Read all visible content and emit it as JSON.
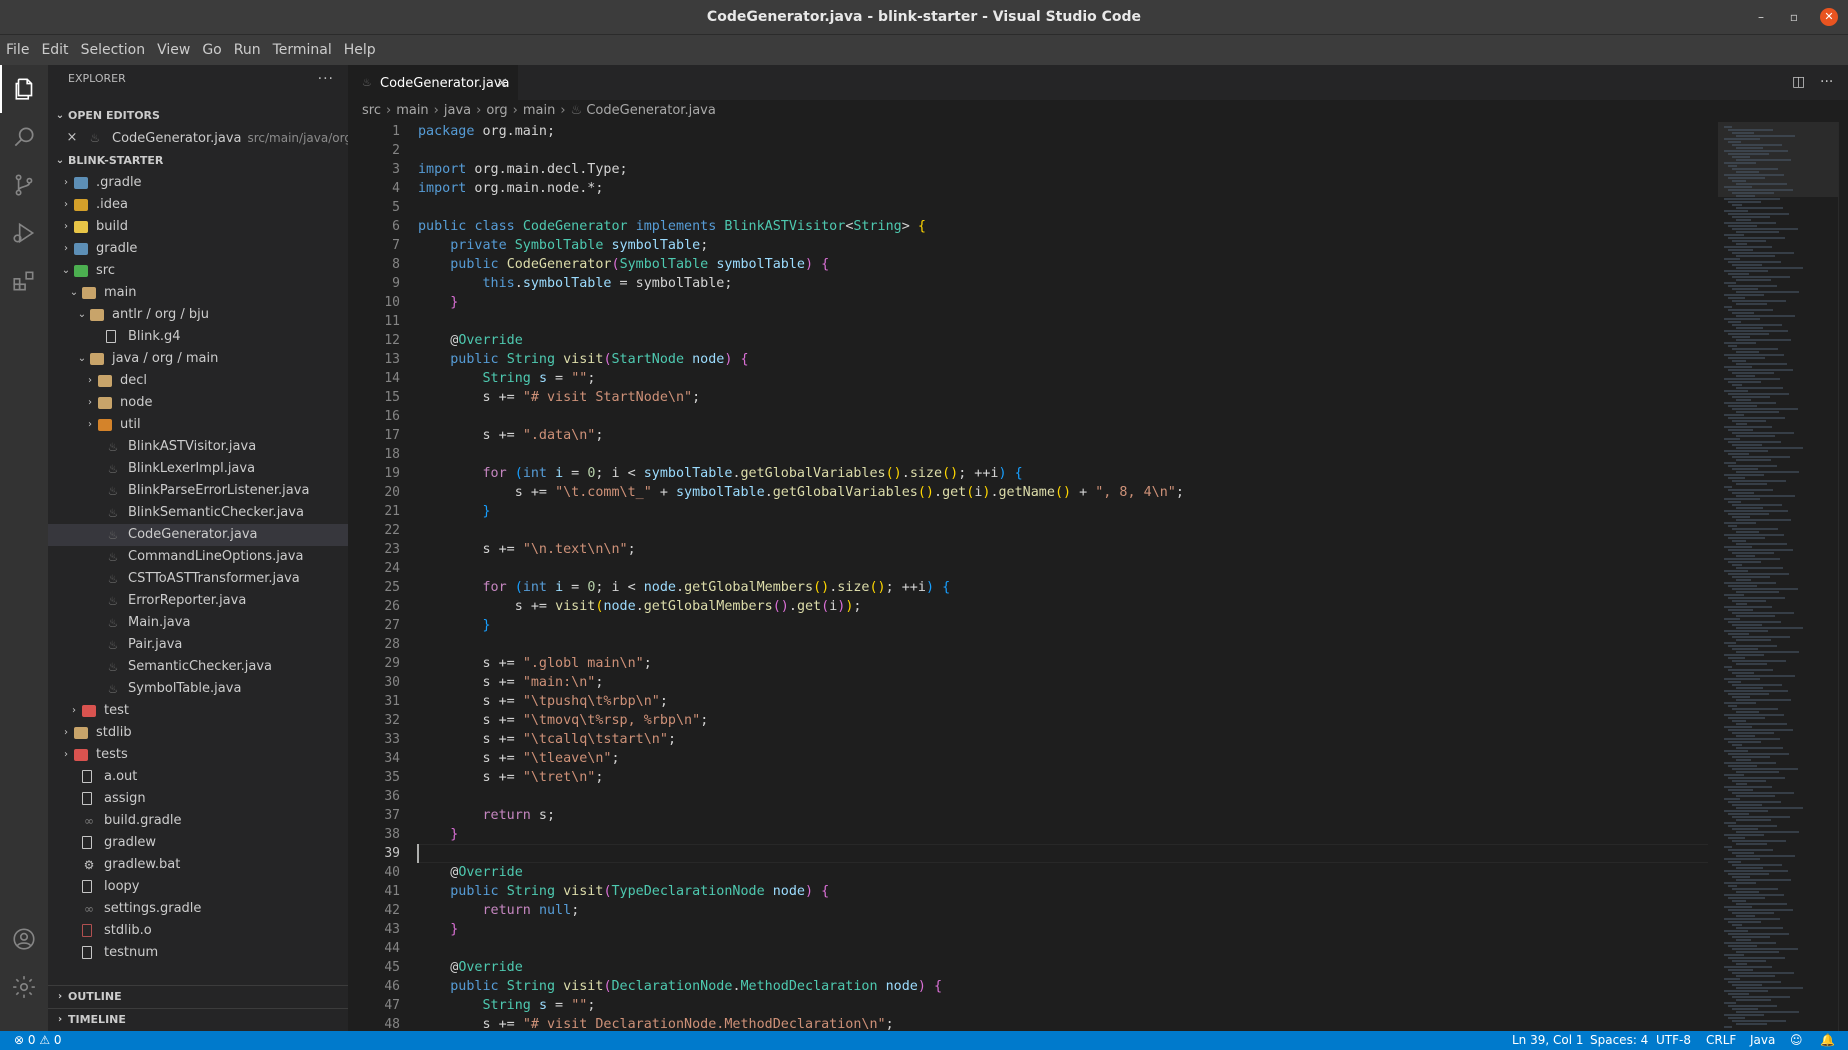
{
  "window": {
    "title": "CodeGenerator.java - blink-starter - Visual Studio Code",
    "controls": [
      "–",
      "▫",
      "✕"
    ]
  },
  "menu": [
    "File",
    "Edit",
    "Selection",
    "View",
    "Go",
    "Run",
    "Terminal",
    "Help"
  ],
  "activity_bar": {
    "top": [
      "explorer-icon",
      "search-icon",
      "source-control-icon",
      "run-debug-icon",
      "extensions-icon"
    ],
    "bottom": [
      "account-icon",
      "manage-gear-icon"
    ]
  },
  "explorer": {
    "header": "EXPLORER",
    "more": "···",
    "open_editors": {
      "title": "OPEN EDITORS",
      "items": [
        {
          "name": "CodeGenerator.java",
          "path": "src/main/java/org/..."
        }
      ]
    },
    "project": {
      "title": "BLINK-STARTER",
      "tree": [
        {
          "label": ".gradle",
          "depth": 0,
          "kind": "folder",
          "twisty": "›",
          "icon_color": "#5d8fb6"
        },
        {
          "label": ".idea",
          "depth": 0,
          "kind": "folder",
          "twisty": "›",
          "icon_color": "#d4a02a"
        },
        {
          "label": "build",
          "depth": 0,
          "kind": "folder",
          "twisty": "›",
          "icon_color": "#e8c547"
        },
        {
          "label": "gradle",
          "depth": 0,
          "kind": "folder",
          "twisty": "›",
          "icon_color": "#5d8fb6"
        },
        {
          "label": "src",
          "depth": 0,
          "kind": "folder",
          "twisty": "⌄",
          "icon_color": "#4caf50"
        },
        {
          "label": "main",
          "depth": 1,
          "kind": "folder",
          "twisty": "⌄",
          "icon_color": "#c8a46a"
        },
        {
          "label": "antlr / org / bju",
          "depth": 2,
          "kind": "folder",
          "twisty": "⌄",
          "icon_color": "#c8a46a"
        },
        {
          "label": "Blink.g4",
          "depth": 3,
          "kind": "file"
        },
        {
          "label": "java / org / main",
          "depth": 2,
          "kind": "folder",
          "twisty": "⌄",
          "icon_color": "#c8a46a"
        },
        {
          "label": "decl",
          "depth": 3,
          "kind": "folder",
          "twisty": "›",
          "icon_color": "#c8a46a"
        },
        {
          "label": "node",
          "depth": 3,
          "kind": "folder",
          "twisty": "›",
          "icon_color": "#c8a46a"
        },
        {
          "label": "util",
          "depth": 3,
          "kind": "folder",
          "twisty": "›",
          "icon_color": "#d4832a"
        },
        {
          "label": "BlinkASTVisitor.java",
          "depth": 3,
          "kind": "java"
        },
        {
          "label": "BlinkLexerImpl.java",
          "depth": 3,
          "kind": "java"
        },
        {
          "label": "BlinkParseErrorListener.java",
          "depth": 3,
          "kind": "java"
        },
        {
          "label": "BlinkSemanticChecker.java",
          "depth": 3,
          "kind": "java"
        },
        {
          "label": "CodeGenerator.java",
          "depth": 3,
          "kind": "java",
          "selected": true
        },
        {
          "label": "CommandLineOptions.java",
          "depth": 3,
          "kind": "java"
        },
        {
          "label": "CSTToASTTransformer.java",
          "depth": 3,
          "kind": "java"
        },
        {
          "label": "ErrorReporter.java",
          "depth": 3,
          "kind": "java"
        },
        {
          "label": "Main.java",
          "depth": 3,
          "kind": "java"
        },
        {
          "label": "Pair.java",
          "depth": 3,
          "kind": "java"
        },
        {
          "label": "SemanticChecker.java",
          "depth": 3,
          "kind": "java"
        },
        {
          "label": "SymbolTable.java",
          "depth": 3,
          "kind": "java"
        },
        {
          "label": "test",
          "depth": 1,
          "kind": "folder",
          "twisty": "›",
          "icon_color": "#d9534f"
        },
        {
          "label": "stdlib",
          "depth": 0,
          "kind": "folder",
          "twisty": "›",
          "icon_color": "#c8a46a"
        },
        {
          "label": "tests",
          "depth": 0,
          "kind": "folder",
          "twisty": "›",
          "icon_color": "#d9534f"
        },
        {
          "label": "a.out",
          "depth": 0,
          "kind": "file"
        },
        {
          "label": "assign",
          "depth": 0,
          "kind": "file"
        },
        {
          "label": "build.gradle",
          "depth": 0,
          "kind": "gradle"
        },
        {
          "label": "gradlew",
          "depth": 0,
          "kind": "file"
        },
        {
          "label": "gradlew.bat",
          "depth": 0,
          "kind": "gear"
        },
        {
          "label": "loopy",
          "depth": 0,
          "kind": "file"
        },
        {
          "label": "settings.gradle",
          "depth": 0,
          "kind": "gradle"
        },
        {
          "label": "stdlib.o",
          "depth": 0,
          "kind": "binary"
        },
        {
          "label": "testnum",
          "depth": 0,
          "kind": "file"
        }
      ]
    },
    "outline": "OUTLINE",
    "timeline": "TIMELINE"
  },
  "editor": {
    "tab": {
      "label": "CodeGenerator.java",
      "close": "×"
    },
    "tab_actions": {
      "split": "◫",
      "more": "···"
    },
    "breadcrumb": [
      "src",
      "main",
      "java",
      "org",
      "main",
      "CodeGenerator.java"
    ],
    "breadcrumb_sep": "›",
    "current_line": 39,
    "colors": {
      "kw": "#569cd6",
      "ctrl": "#c586c0",
      "type": "#4ec9b0",
      "str": "#ce9178",
      "var": "#9cdcfe",
      "fn": "#dcdcaa",
      "num": "#b5cea8",
      "br": "#ffd700",
      "br2": "#da70d6",
      "br3": "#179fff",
      "plain": "#d4d4d4"
    },
    "lines": [
      [
        [
          "kw",
          "package"
        ],
        [
          "p",
          " org.main;"
        ]
      ],
      [],
      [
        [
          "kw",
          "import"
        ],
        [
          "p",
          " org.main.decl.Type;"
        ]
      ],
      [
        [
          "kw",
          "import"
        ],
        [
          "p",
          " org.main.node.*;"
        ]
      ],
      [],
      [
        [
          "kw",
          "public"
        ],
        [
          "p",
          " "
        ],
        [
          "kw",
          "class"
        ],
        [
          "p",
          " "
        ],
        [
          "type",
          "CodeGenerator"
        ],
        [
          "p",
          " "
        ],
        [
          "kw",
          "implements"
        ],
        [
          "p",
          " "
        ],
        [
          "type",
          "BlinkASTVisitor"
        ],
        [
          "p",
          "<"
        ],
        [
          "type",
          "String"
        ],
        [
          "p",
          "> "
        ],
        [
          "br",
          "{"
        ]
      ],
      [
        [
          "p",
          "    "
        ],
        [
          "kw",
          "private"
        ],
        [
          "p",
          " "
        ],
        [
          "type",
          "SymbolTable"
        ],
        [
          "p",
          " "
        ],
        [
          "var",
          "symbolTable"
        ],
        [
          "p",
          ";"
        ]
      ],
      [
        [
          "p",
          "    "
        ],
        [
          "kw",
          "public"
        ],
        [
          "p",
          " "
        ],
        [
          "fn",
          "CodeGenerator"
        ],
        [
          "br2",
          "("
        ],
        [
          "type",
          "SymbolTable"
        ],
        [
          "p",
          " "
        ],
        [
          "var",
          "symbolTable"
        ],
        [
          "br2",
          ")"
        ],
        [
          "p",
          " "
        ],
        [
          "br2",
          "{"
        ]
      ],
      [
        [
          "p",
          "        "
        ],
        [
          "kw",
          "this"
        ],
        [
          "p",
          "."
        ],
        [
          "var",
          "symbolTable"
        ],
        [
          "p",
          " = symbolTable;"
        ]
      ],
      [
        [
          "p",
          "    "
        ],
        [
          "br2",
          "}"
        ]
      ],
      [],
      [
        [
          "p",
          "    @"
        ],
        [
          "type",
          "Override"
        ]
      ],
      [
        [
          "p",
          "    "
        ],
        [
          "kw",
          "public"
        ],
        [
          "p",
          " "
        ],
        [
          "type",
          "String"
        ],
        [
          "p",
          " "
        ],
        [
          "fn",
          "visit"
        ],
        [
          "br2",
          "("
        ],
        [
          "type",
          "StartNode"
        ],
        [
          "p",
          " "
        ],
        [
          "var",
          "node"
        ],
        [
          "br2",
          ")"
        ],
        [
          "p",
          " "
        ],
        [
          "br2",
          "{"
        ]
      ],
      [
        [
          "p",
          "        "
        ],
        [
          "type",
          "String"
        ],
        [
          "p",
          " "
        ],
        [
          "var",
          "s"
        ],
        [
          "p",
          " = "
        ],
        [
          "str",
          "\"\""
        ],
        [
          "p",
          ";"
        ]
      ],
      [
        [
          "p",
          "        s += "
        ],
        [
          "str",
          "\"# visit StartNode\\n\""
        ],
        [
          "p",
          ";"
        ]
      ],
      [],
      [
        [
          "p",
          "        s += "
        ],
        [
          "str",
          "\".data\\n\""
        ],
        [
          "p",
          ";"
        ]
      ],
      [],
      [
        [
          "p",
          "        "
        ],
        [
          "ctrl",
          "for"
        ],
        [
          "p",
          " "
        ],
        [
          "br3",
          "("
        ],
        [
          "kw",
          "int"
        ],
        [
          "p",
          " "
        ],
        [
          "var",
          "i"
        ],
        [
          "p",
          " = "
        ],
        [
          "num",
          "0"
        ],
        [
          "p",
          "; i < "
        ],
        [
          "var",
          "symbolTable"
        ],
        [
          "p",
          "."
        ],
        [
          "fn",
          "getGlobalVariables"
        ],
        [
          "br",
          "()"
        ],
        [
          "p",
          "."
        ],
        [
          "fn",
          "size"
        ],
        [
          "br",
          "()"
        ],
        [
          "p",
          "; ++i"
        ],
        [
          "br3",
          ")"
        ],
        [
          "p",
          " "
        ],
        [
          "br3",
          "{"
        ]
      ],
      [
        [
          "p",
          "            s += "
        ],
        [
          "str",
          "\"\\t.comm\\t_\""
        ],
        [
          "p",
          " + "
        ],
        [
          "var",
          "symbolTable"
        ],
        [
          "p",
          "."
        ],
        [
          "fn",
          "getGlobalVariables"
        ],
        [
          "br",
          "()"
        ],
        [
          "p",
          "."
        ],
        [
          "fn",
          "get"
        ],
        [
          "br",
          "("
        ],
        [
          "p",
          "i"
        ],
        [
          "br",
          ")"
        ],
        [
          "p",
          "."
        ],
        [
          "fn",
          "getName"
        ],
        [
          "br",
          "()"
        ],
        [
          "p",
          " + "
        ],
        [
          "str",
          "\", 8, 4\\n\""
        ],
        [
          "p",
          ";"
        ]
      ],
      [
        [
          "p",
          "        "
        ],
        [
          "br3",
          "}"
        ]
      ],
      [],
      [
        [
          "p",
          "        s += "
        ],
        [
          "str",
          "\"\\n.text\\n\\n\""
        ],
        [
          "p",
          ";"
        ]
      ],
      [],
      [
        [
          "p",
          "        "
        ],
        [
          "ctrl",
          "for"
        ],
        [
          "p",
          " "
        ],
        [
          "br3",
          "("
        ],
        [
          "kw",
          "int"
        ],
        [
          "p",
          " "
        ],
        [
          "var",
          "i"
        ],
        [
          "p",
          " = "
        ],
        [
          "num",
          "0"
        ],
        [
          "p",
          "; i < "
        ],
        [
          "var",
          "node"
        ],
        [
          "p",
          "."
        ],
        [
          "fn",
          "getGlobalMembers"
        ],
        [
          "br",
          "()"
        ],
        [
          "p",
          "."
        ],
        [
          "fn",
          "size"
        ],
        [
          "br",
          "()"
        ],
        [
          "p",
          "; ++i"
        ],
        [
          "br3",
          ")"
        ],
        [
          "p",
          " "
        ],
        [
          "br3",
          "{"
        ]
      ],
      [
        [
          "p",
          "            s += "
        ],
        [
          "fn",
          "visit"
        ],
        [
          "br",
          "("
        ],
        [
          "var",
          "node"
        ],
        [
          "p",
          "."
        ],
        [
          "fn",
          "getGlobalMembers"
        ],
        [
          "br2",
          "()"
        ],
        [
          "p",
          "."
        ],
        [
          "fn",
          "get"
        ],
        [
          "br2",
          "("
        ],
        [
          "p",
          "i"
        ],
        [
          "br2",
          ")"
        ],
        [
          "br",
          ")"
        ],
        [
          "p",
          ";"
        ]
      ],
      [
        [
          "p",
          "        "
        ],
        [
          "br3",
          "}"
        ]
      ],
      [],
      [
        [
          "p",
          "        s += "
        ],
        [
          "str",
          "\".globl main\\n\""
        ],
        [
          "p",
          ";"
        ]
      ],
      [
        [
          "p",
          "        s += "
        ],
        [
          "str",
          "\"main:\\n\""
        ],
        [
          "p",
          ";"
        ]
      ],
      [
        [
          "p",
          "        s += "
        ],
        [
          "str",
          "\"\\tpushq\\t%rbp\\n\""
        ],
        [
          "p",
          ";"
        ]
      ],
      [
        [
          "p",
          "        s += "
        ],
        [
          "str",
          "\"\\tmovq\\t%rsp, %rbp\\n\""
        ],
        [
          "p",
          ";"
        ]
      ],
      [
        [
          "p",
          "        s += "
        ],
        [
          "str",
          "\"\\tcallq\\tstart\\n\""
        ],
        [
          "p",
          ";"
        ]
      ],
      [
        [
          "p",
          "        s += "
        ],
        [
          "str",
          "\"\\tleave\\n\""
        ],
        [
          "p",
          ";"
        ]
      ],
      [
        [
          "p",
          "        s += "
        ],
        [
          "str",
          "\"\\tret\\n\""
        ],
        [
          "p",
          ";"
        ]
      ],
      [],
      [
        [
          "p",
          "        "
        ],
        [
          "ctrl",
          "return"
        ],
        [
          "p",
          " s;"
        ]
      ],
      [
        [
          "p",
          "    "
        ],
        [
          "br2",
          "}"
        ]
      ],
      [],
      [
        [
          "p",
          "    @"
        ],
        [
          "type",
          "Override"
        ]
      ],
      [
        [
          "p",
          "    "
        ],
        [
          "kw",
          "public"
        ],
        [
          "p",
          " "
        ],
        [
          "type",
          "String"
        ],
        [
          "p",
          " "
        ],
        [
          "fn",
          "visit"
        ],
        [
          "br2",
          "("
        ],
        [
          "type",
          "TypeDeclarationNode"
        ],
        [
          "p",
          " "
        ],
        [
          "var",
          "node"
        ],
        [
          "br2",
          ")"
        ],
        [
          "p",
          " "
        ],
        [
          "br2",
          "{"
        ]
      ],
      [
        [
          "p",
          "        "
        ],
        [
          "ctrl",
          "return"
        ],
        [
          "p",
          " "
        ],
        [
          "kw",
          "null"
        ],
        [
          "p",
          ";"
        ]
      ],
      [
        [
          "p",
          "    "
        ],
        [
          "br2",
          "}"
        ]
      ],
      [],
      [
        [
          "p",
          "    @"
        ],
        [
          "type",
          "Override"
        ]
      ],
      [
        [
          "p",
          "    "
        ],
        [
          "kw",
          "public"
        ],
        [
          "p",
          " "
        ],
        [
          "type",
          "String"
        ],
        [
          "p",
          " "
        ],
        [
          "fn",
          "visit"
        ],
        [
          "br2",
          "("
        ],
        [
          "type",
          "DeclarationNode"
        ],
        [
          "p",
          "."
        ],
        [
          "type",
          "MethodDeclaration"
        ],
        [
          "p",
          " "
        ],
        [
          "var",
          "node"
        ],
        [
          "br2",
          ")"
        ],
        [
          "p",
          " "
        ],
        [
          "br2",
          "{"
        ]
      ],
      [
        [
          "p",
          "        "
        ],
        [
          "type",
          "String"
        ],
        [
          "p",
          " "
        ],
        [
          "var",
          "s"
        ],
        [
          "p",
          " = "
        ],
        [
          "str",
          "\"\""
        ],
        [
          "p",
          ";"
        ]
      ],
      [
        [
          "p",
          "        s += "
        ],
        [
          "str",
          "\"# visit DeclarationNode.MethodDeclaration\\n\""
        ],
        [
          "p",
          ";"
        ]
      ]
    ]
  },
  "status": {
    "problems": "⊗ 0 ⚠ 0",
    "position": "Ln 39, Col 1",
    "spaces": "Spaces: 4",
    "encoding": "UTF-8",
    "eol": "CRLF",
    "language": "Java",
    "feedback": "☺",
    "notifications": "🔔"
  }
}
